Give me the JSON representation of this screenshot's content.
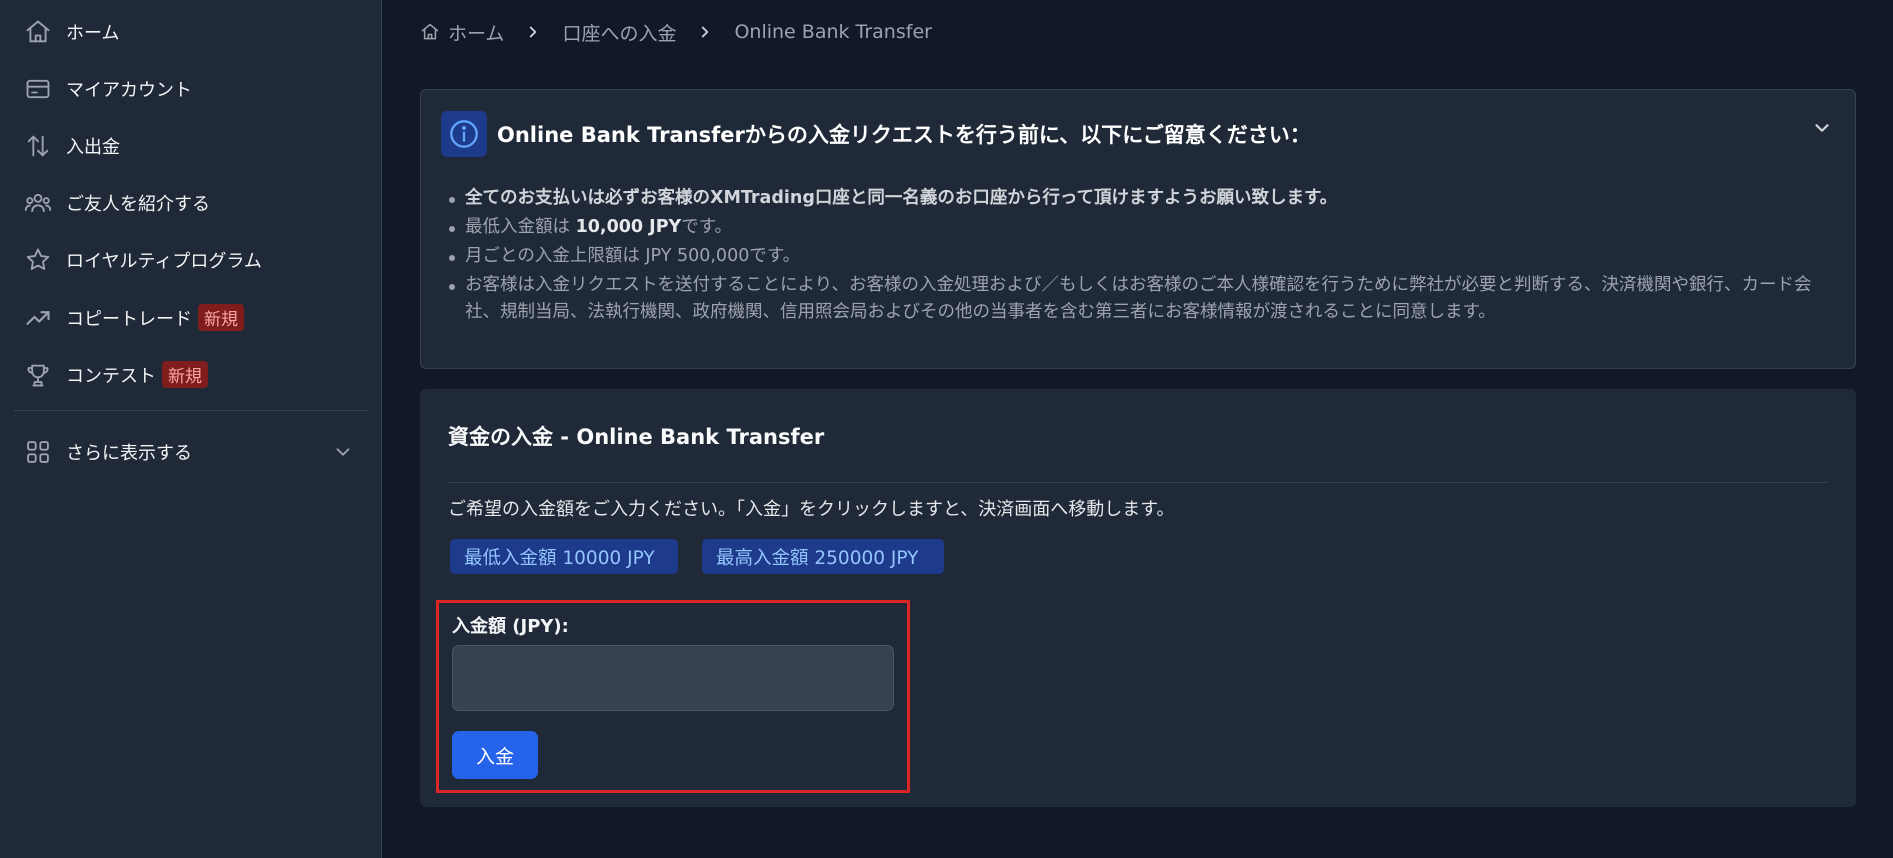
{
  "sidebar": {
    "items": [
      {
        "label": "ホーム",
        "icon": "home-icon"
      },
      {
        "label": "マイアカウント",
        "icon": "card-icon"
      },
      {
        "label": "入出金",
        "icon": "transfer-arrows-icon"
      },
      {
        "label": "ご友人を紹介する",
        "icon": "users-icon"
      },
      {
        "label": "ロイヤルティプログラム",
        "icon": "star-icon"
      },
      {
        "label": "コピートレード",
        "icon": "trending-up-icon",
        "badge": "新規"
      },
      {
        "label": "コンテスト",
        "icon": "trophy-icon",
        "badge": "新規"
      }
    ],
    "more_label": "さらに表示する"
  },
  "breadcrumb": {
    "home": "ホーム",
    "deposit": "口座への入金",
    "current": "Online Bank Transfer"
  },
  "notice": {
    "title": "Online Bank Transferからの入金リクエストを行う前に、以下にご留意ください：",
    "items": [
      "全てのお支払いは必ずお客様のXMTrading口座と同一名義のお口座から行って頂けますようお願い致します。",
      {
        "prefix": "最低入金額は ",
        "bold": "10,000 JPY",
        "suffix": "です。"
      },
      "月ごとの入金上限額は JPY 500,000です。",
      "お客様は入金リクエストを送付することにより、お客様の入金処理および／もしくはお客様のご本人様確認を行うために弊社が必要と判断する、決済機関や銀行、カード会社、規制当局、法執行機関、政府機関、信用照会局およびその他の当事者を含む第三者にお客様情報が渡されることに同意します。"
    ]
  },
  "deposit": {
    "title": "資金の入金 - Online Bank Transfer",
    "instruction": "ご希望の入金額をご入力ください。「入金」をクリックしますと、決済画面へ移動します。",
    "min_chip": "最低入金額 10000 JPY",
    "max_chip": "最高入金額 250000 JPY",
    "amount_label": "入金額 (JPY):",
    "amount_value": "",
    "submit_label": "入金"
  },
  "colors": {
    "accent": "#2563eb",
    "highlight": "#dc2626",
    "badge_bg": "#7f1d1d",
    "chip_bg": "#1e3a8a"
  }
}
